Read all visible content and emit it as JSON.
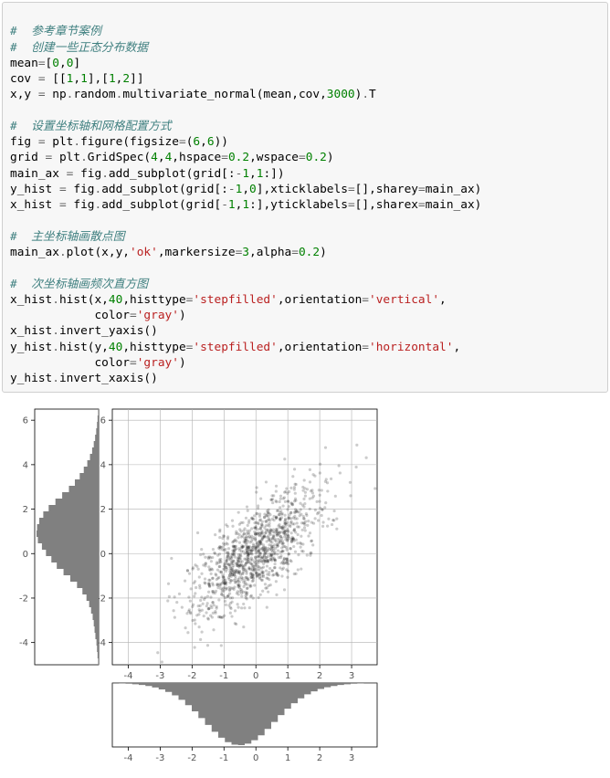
{
  "code": {
    "l1": "#  参考章节案例",
    "l2": "#  创建一些正态分布数据",
    "l3a": "mean",
    "l3b": "=",
    "l3c": "[",
    "l3d": "0",
    "l3e": ",",
    "l3f": "0",
    "l3g": "]",
    "l4a": "cov ",
    "l4b": "=",
    "l4c": " [[",
    "l4d": "1",
    "l4e": ",",
    "l4f": "1",
    "l4g": "],[",
    "l4h": "1",
    "l4i": ",",
    "l4j": "2",
    "l4k": "]]",
    "l5a": "x,y ",
    "l5b": "=",
    "l5c": " np",
    "l5d": ".",
    "l5e": "random",
    "l5f": ".",
    "l5g": "multivariate_normal(mean,cov,",
    "l5h": "3000",
    "l5i": ")",
    "l5j": ".",
    "l5k": "T",
    "l7": "#  设置坐标轴和网格配置方式",
    "l8a": "fig ",
    "l8b": "=",
    "l8c": " plt",
    "l8d": ".",
    "l8e": "figure(figsize",
    "l8f": "=",
    "l8g": "(",
    "l8h": "6",
    "l8i": ",",
    "l8j": "6",
    "l8k": "))",
    "l9a": "grid ",
    "l9b": "=",
    "l9c": " plt",
    "l9d": ".",
    "l9e": "GridSpec(",
    "l9f": "4",
    "l9g": ",",
    "l9h": "4",
    "l9i": ",hspace",
    "l9j": "=",
    "l9k": "0.2",
    "l9l": ",wspace",
    "l9m": "=",
    "l9n": "0.2",
    "l9o": ")",
    "l10a": "main_ax ",
    "l10b": "=",
    "l10c": " fig",
    "l10d": ".",
    "l10e": "add_subplot(grid[:",
    "l10f": "-",
    "l10g": "1",
    "l10h": ",",
    "l10i": "1",
    "l10j": ":])",
    "l11a": "y_hist ",
    "l11b": "=",
    "l11c": " fig",
    "l11d": ".",
    "l11e": "add_subplot(grid[:",
    "l11f": "-",
    "l11g": "1",
    "l11h": ",",
    "l11i": "0",
    "l11j": "],xticklabels",
    "l11k": "=",
    "l11l": "[],sharey",
    "l11m": "=",
    "l11n": "main_ax)",
    "l12a": "x_hist ",
    "l12b": "=",
    "l12c": " fig",
    "l12d": ".",
    "l12e": "add_subplot(grid[",
    "l12f": "-",
    "l12g": "1",
    "l12h": ",",
    "l12i": "1",
    "l12j": ":],yticklabels",
    "l12k": "=",
    "l12l": "[],sharex",
    "l12m": "=",
    "l12n": "main_ax)",
    "l14": "#  主坐标轴画散点图",
    "l15a": "main_ax",
    "l15b": ".",
    "l15c": "plot(x,y,",
    "l15d": "'ok'",
    "l15e": ",markersize",
    "l15f": "=",
    "l15g": "3",
    "l15h": ",alpha",
    "l15i": "=",
    "l15j": "0.2",
    "l15k": ")",
    "l17": "#  次坐标轴画频次直方图",
    "l18a": "x_hist",
    "l18b": ".",
    "l18c": "hist(x,",
    "l18d": "40",
    "l18e": ",histtype",
    "l18f": "=",
    "l18g": "'stepfilled'",
    "l18h": ",orientation",
    "l18i": "=",
    "l18j": "'vertical'",
    "l18k": ",",
    "l19a": "            color",
    "l19b": "=",
    "l19c": "'gray'",
    "l19d": ")",
    "l20a": "x_hist",
    "l20b": ".",
    "l20c": "invert_yaxis()",
    "l21a": "y_hist",
    "l21b": ".",
    "l21c": "hist(y,",
    "l21d": "40",
    "l21e": ",histtype",
    "l21f": "=",
    "l21g": "'stepfilled'",
    "l21h": ",orientation",
    "l21i": "=",
    "l21j": "'horizontal'",
    "l21k": ",",
    "l22a": "            color",
    "l22b": "=",
    "l22c": "'gray'",
    "l22d": ")",
    "l23a": "y_hist",
    "l23b": ".",
    "l23c": "invert_xaxis()"
  },
  "chart_data": {
    "type": "scatter+hist",
    "description": "Multivariate-normal scatter with marginal histograms",
    "mean": [
      0,
      0
    ],
    "cov": [
      [
        1,
        1
      ],
      [
        1,
        2
      ]
    ],
    "n_points": 3000,
    "scatter": {
      "marker": "o",
      "color": "black",
      "markersize": 3,
      "alpha": 0.2,
      "xrange": [
        -4.5,
        3.8
      ],
      "yrange": [
        -5.0,
        6.5
      ]
    },
    "main_axis": {
      "xticks": [
        -4,
        -3,
        -2,
        -1,
        0,
        1,
        2,
        3
      ],
      "yticks": [
        -4,
        -2,
        0,
        2,
        4,
        6
      ],
      "grid": true
    },
    "y_hist": {
      "bins": 40,
      "orientation": "horizontal",
      "color": "gray",
      "histtype": "stepfilled",
      "invert_xaxis": true,
      "yticks": [
        -4,
        -2,
        0,
        2,
        4,
        6
      ],
      "approx_counts": [
        2,
        4,
        6,
        8,
        12,
        15,
        18,
        22,
        28,
        35,
        45,
        60,
        80,
        105,
        130,
        155,
        175,
        195,
        210,
        225,
        230,
        228,
        220,
        205,
        185,
        160,
        135,
        110,
        88,
        70,
        55,
        42,
        32,
        24,
        18,
        13,
        9,
        6,
        4,
        2
      ]
    },
    "x_hist": {
      "bins": 40,
      "orientation": "vertical",
      "color": "gray",
      "histtype": "stepfilled",
      "invert_yaxis": true,
      "xticks": [
        -4,
        -3,
        -2,
        -1,
        0,
        1,
        2,
        3
      ],
      "approx_counts": [
        1,
        2,
        3,
        5,
        8,
        12,
        18,
        26,
        36,
        50,
        68,
        90,
        115,
        142,
        170,
        198,
        222,
        240,
        250,
        252,
        246,
        232,
        212,
        186,
        158,
        130,
        104,
        82,
        62,
        46,
        34,
        24,
        17,
        12,
        8,
        5,
        3,
        2,
        1,
        1
      ]
    }
  },
  "ticks": {
    "main_y": [
      "-4",
      "-2",
      "0",
      "2",
      "4",
      "6"
    ],
    "main_x": [
      "-4",
      "-3",
      "-2",
      "-1",
      "0",
      "1",
      "2",
      "3"
    ],
    "yhist_y": [
      "-4",
      "-2",
      "0",
      "2",
      "4",
      "6"
    ],
    "xhist_x": [
      "-4",
      "-3",
      "-2",
      "-1",
      "0",
      "1",
      "2",
      "3"
    ]
  }
}
